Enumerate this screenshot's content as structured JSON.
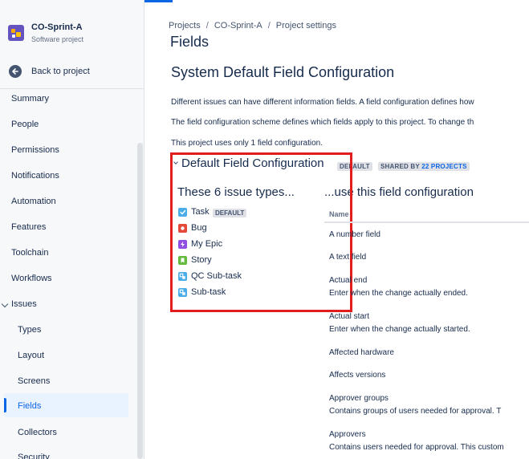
{
  "project": {
    "name": "CO-Sprint-A",
    "type": "Software project"
  },
  "sidebar": {
    "back_label": "Back to project",
    "items": [
      {
        "label": "Summary"
      },
      {
        "label": "People"
      },
      {
        "label": "Permissions"
      },
      {
        "label": "Notifications"
      },
      {
        "label": "Automation"
      },
      {
        "label": "Features"
      },
      {
        "label": "Toolchain"
      },
      {
        "label": "Workflows"
      },
      {
        "label": "Issues"
      },
      {
        "label": "Types"
      },
      {
        "label": "Layout"
      },
      {
        "label": "Screens"
      },
      {
        "label": "Fields"
      },
      {
        "label": "Collectors"
      },
      {
        "label": "Security"
      }
    ]
  },
  "breadcrumb": {
    "items": [
      "Projects",
      "CO-Sprint-A",
      "Project settings"
    ],
    "separator": "/"
  },
  "page": {
    "title": "Fields",
    "section_title": "System Default Field Configuration",
    "para1": "Different issues can have different information fields. A field configuration defines how",
    "para2": "The field configuration scheme defines which fields apply to this project. To change th",
    "para3": "This project uses only 1 field configuration."
  },
  "config": {
    "title": "Default Field Configuration",
    "default_badge": "DEFAULT",
    "shared_prefix": "SHARED BY ",
    "shared_link": "22 PROJECTS",
    "left_heading": "These 6 issue types...",
    "right_heading": "...use this field configuration",
    "issue_types": [
      {
        "label": "Task",
        "badge": "DEFAULT",
        "color": "#4bade8",
        "icon": "task-icon"
      },
      {
        "label": "Bug",
        "badge": "",
        "color": "#e5493a",
        "icon": "bug-icon"
      },
      {
        "label": "My Epic",
        "badge": "",
        "color": "#904ee2",
        "icon": "epic-icon"
      },
      {
        "label": "Story",
        "badge": "",
        "color": "#63ba3c",
        "icon": "story-icon"
      },
      {
        "label": "QC Sub-task",
        "badge": "",
        "color": "#4bade8",
        "icon": "subtask-icon"
      },
      {
        "label": "Sub-task",
        "badge": "",
        "color": "#4bade8",
        "icon": "subtask-icon"
      }
    ]
  },
  "fields_table": {
    "header": "Name",
    "rows": [
      {
        "name": "A number field",
        "desc": ""
      },
      {
        "name": "A text field",
        "desc": ""
      },
      {
        "name": "Actual end",
        "desc": "Enter when the change actually ended."
      },
      {
        "name": "Actual start",
        "desc": "Enter when the change actually started."
      },
      {
        "name": "Affected hardware",
        "desc": ""
      },
      {
        "name": "Affects versions",
        "desc": ""
      },
      {
        "name": "Approver groups",
        "desc": "Contains groups of users needed for approval. T"
      },
      {
        "name": "Approvers",
        "desc": "Contains users needed for approval. This custom"
      }
    ]
  }
}
